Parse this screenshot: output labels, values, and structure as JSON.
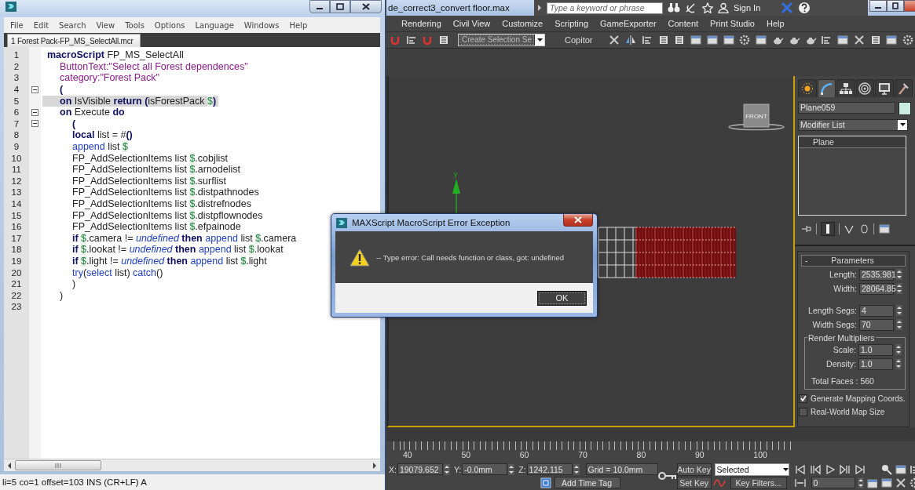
{
  "editor": {
    "menu": [
      "File",
      "Edit",
      "Search",
      "View",
      "Tools",
      "Options",
      "Language",
      "Windows",
      "Help"
    ],
    "tab": "1 Forest Pack-FP_MS_SelectAll.mcr",
    "lines": [
      {
        "number": "1",
        "current": false,
        "fold": false,
        "tokens": [
          {
            "kind": "keyword",
            "text": "macroScript"
          },
          {
            "kind": "plain",
            "text": " FP_MS_SelectAll"
          }
        ]
      },
      {
        "number": "2",
        "current": false,
        "fold": false,
        "tokens": [
          {
            "kind": "string",
            "text": "\tButtonText:\"Select all Forest dependences\""
          }
        ]
      },
      {
        "number": "3",
        "current": false,
        "fold": false,
        "tokens": [
          {
            "kind": "string",
            "text": "\tcategory:\"Forest Pack\""
          }
        ]
      },
      {
        "number": "4",
        "current": false,
        "fold": true,
        "tokens": [
          {
            "kind": "keyword",
            "text": "\t("
          }
        ]
      },
      {
        "number": "5",
        "current": true,
        "fold": false,
        "tokens": [
          {
            "kind": "keyword",
            "text": "\ton"
          },
          {
            "kind": "plain",
            "text": " IsVisible "
          },
          {
            "kind": "keyword",
            "text": "return ("
          },
          {
            "kind": "plain",
            "text": "isForestPack "
          },
          {
            "kind": "dollar",
            "text": "$"
          },
          {
            "kind": "keyword",
            "text": ")"
          }
        ]
      },
      {
        "number": "6",
        "current": false,
        "fold": true,
        "tokens": [
          {
            "kind": "keyword",
            "text": "\ton"
          },
          {
            "kind": "plain",
            "text": " Execute "
          },
          {
            "kind": "keyword",
            "text": "do"
          }
        ]
      },
      {
        "number": "7",
        "current": false,
        "fold": true,
        "tokens": [
          {
            "kind": "keyword",
            "text": "\t\t("
          }
        ]
      },
      {
        "number": "8",
        "current": false,
        "fold": false,
        "tokens": [
          {
            "kind": "keyword",
            "text": "\t\tlocal"
          },
          {
            "kind": "plain",
            "text": " list = #"
          },
          {
            "kind": "keyword",
            "text": "()"
          }
        ]
      },
      {
        "number": "9",
        "current": false,
        "fold": false,
        "tokens": [
          {
            "kind": "function",
            "text": "\t\tappend"
          },
          {
            "kind": "plain",
            "text": " list "
          },
          {
            "kind": "dollar",
            "text": "$"
          }
        ]
      },
      {
        "number": "10",
        "current": false,
        "fold": false,
        "tokens": [
          {
            "kind": "plain",
            "text": "\t\tFP_AddSelectionItems list "
          },
          {
            "kind": "dollar",
            "text": "$"
          },
          {
            "kind": "plain",
            "text": ".cobjlist"
          }
        ]
      },
      {
        "number": "11",
        "current": false,
        "fold": false,
        "tokens": [
          {
            "kind": "plain",
            "text": "\t\tFP_AddSelectionItems list "
          },
          {
            "kind": "dollar",
            "text": "$"
          },
          {
            "kind": "plain",
            "text": ".arnodelist"
          }
        ]
      },
      {
        "number": "12",
        "current": false,
        "fold": false,
        "tokens": [
          {
            "kind": "plain",
            "text": "\t\tFP_AddSelectionItems list "
          },
          {
            "kind": "dollar",
            "text": "$"
          },
          {
            "kind": "plain",
            "text": ".surflist"
          }
        ]
      },
      {
        "number": "13",
        "current": false,
        "fold": false,
        "tokens": [
          {
            "kind": "plain",
            "text": "\t\tFP_AddSelectionItems list "
          },
          {
            "kind": "dollar",
            "text": "$"
          },
          {
            "kind": "plain",
            "text": ".distpathnodes"
          }
        ]
      },
      {
        "number": "14",
        "current": false,
        "fold": false,
        "tokens": [
          {
            "kind": "plain",
            "text": "\t\tFP_AddSelectionItems list "
          },
          {
            "kind": "dollar",
            "text": "$"
          },
          {
            "kind": "plain",
            "text": ".distrefnodes"
          }
        ]
      },
      {
        "number": "15",
        "current": false,
        "fold": false,
        "tokens": [
          {
            "kind": "plain",
            "text": "\t\tFP_AddSelectionItems list "
          },
          {
            "kind": "dollar",
            "text": "$"
          },
          {
            "kind": "plain",
            "text": ".distpflownodes"
          }
        ]
      },
      {
        "number": "16",
        "current": false,
        "fold": false,
        "tokens": [
          {
            "kind": "plain",
            "text": "\t\tFP_AddSelectionItems list "
          },
          {
            "kind": "dollar",
            "text": "$"
          },
          {
            "kind": "plain",
            "text": ".efpainode"
          }
        ]
      },
      {
        "number": "17",
        "current": false,
        "fold": false,
        "tokens": [
          {
            "kind": "keyword",
            "text": "\t\tif "
          },
          {
            "kind": "dollar",
            "text": "$"
          },
          {
            "kind": "plain",
            "text": ".camera != "
          },
          {
            "kind": "constant",
            "text": "undefined "
          },
          {
            "kind": "keyword",
            "text": "then "
          },
          {
            "kind": "function",
            "text": "append"
          },
          {
            "kind": "plain",
            "text": " list "
          },
          {
            "kind": "dollar",
            "text": "$"
          },
          {
            "kind": "plain",
            "text": ".camera"
          }
        ]
      },
      {
        "number": "18",
        "current": false,
        "fold": false,
        "tokens": [
          {
            "kind": "keyword",
            "text": "\t\tif "
          },
          {
            "kind": "dollar",
            "text": "$"
          },
          {
            "kind": "plain",
            "text": ".lookat != "
          },
          {
            "kind": "constant",
            "text": "undefined "
          },
          {
            "kind": "keyword",
            "text": "then "
          },
          {
            "kind": "function",
            "text": "append"
          },
          {
            "kind": "plain",
            "text": " list "
          },
          {
            "kind": "dollar",
            "text": "$"
          },
          {
            "kind": "plain",
            "text": ".lookat"
          }
        ]
      },
      {
        "number": "19",
        "current": false,
        "fold": false,
        "tokens": [
          {
            "kind": "keyword",
            "text": "\t\tif "
          },
          {
            "kind": "dollar",
            "text": "$"
          },
          {
            "kind": "plain",
            "text": ".light != "
          },
          {
            "kind": "constant",
            "text": "undefined "
          },
          {
            "kind": "keyword",
            "text": "then "
          },
          {
            "kind": "function",
            "text": "append"
          },
          {
            "kind": "plain",
            "text": " list "
          },
          {
            "kind": "dollar",
            "text": "$"
          },
          {
            "kind": "plain",
            "text": ".light"
          }
        ]
      },
      {
        "number": "20",
        "current": false,
        "fold": false,
        "tokens": [
          {
            "kind": "function",
            "text": "\t\ttry"
          },
          {
            "kind": "plain",
            "text": "("
          },
          {
            "kind": "function",
            "text": "select"
          },
          {
            "kind": "plain",
            "text": " list) "
          },
          {
            "kind": "function",
            "text": "catch"
          },
          {
            "kind": "plain",
            "text": "()"
          }
        ]
      },
      {
        "number": "21",
        "current": false,
        "fold": false,
        "tokens": [
          {
            "kind": "plain",
            "text": "\t\t)"
          }
        ]
      },
      {
        "number": "22",
        "current": false,
        "fold": false,
        "tokens": [
          {
            "kind": "plain",
            "text": "\t)"
          }
        ]
      },
      {
        "number": "23",
        "current": false,
        "fold": false
      }
    ],
    "status": "li=5 co=1 offset=103 INS (CR+LF) A"
  },
  "max": {
    "title": "de_correct3_convert floor.max",
    "search": {
      "placeholder": "Type a keyword or phrase"
    },
    "sign_in": "Sign In",
    "menu": [
      "Rendering",
      "Civil View",
      "Customize",
      "Scripting",
      "GameExporter",
      "Content",
      "Print Studio",
      "Help"
    ],
    "selection_set": "Create Selection Se",
    "copitor": "Copitor",
    "viewport": {
      "axis_label": "y",
      "viewcube": "FRONT"
    },
    "command_panel": {
      "tabs": [
        {
          "selected": false
        },
        {
          "selected": true
        },
        {
          "selected": false
        },
        {
          "selected": false
        },
        {
          "selected": false
        },
        {
          "selected": false
        }
      ],
      "object_name": "Plane059",
      "modifier_list": "Modifier List",
      "stack": [
        "Plane"
      ],
      "rollout": {
        "toggle": "-",
        "title": "Parameters",
        "fields": [
          {
            "label": "Length:",
            "value": "2535.981"
          },
          {
            "label": "Width:",
            "value": "28064.85"
          },
          {
            "label": "Length Segs:",
            "value": "4"
          },
          {
            "label": "Width Segs:",
            "value": "70"
          }
        ],
        "group": {
          "title": "Render Multipliers",
          "fields": [
            {
              "label": "Scale:",
              "value": "1.0"
            },
            {
              "label": "Density:",
              "value": "1.0"
            }
          ],
          "total_faces": "Total Faces : 560"
        },
        "checkboxes": [
          {
            "label": "Generate Mapping Coords.",
            "checked": true
          },
          {
            "label": "Real-World Map Size",
            "checked": false
          }
        ]
      }
    },
    "timeline": {
      "ticks": [
        "40",
        "50",
        "60",
        "70",
        "80",
        "90",
        "100"
      ]
    },
    "status": {
      "coords": [
        {
          "label": "X:",
          "value": "19079.652"
        },
        {
          "label": "Y:",
          "value": "-0.0mm"
        },
        {
          "label": "Z:",
          "value": "1242.115"
        }
      ],
      "grid": "Grid = 10.0mm",
      "add_time_tag": "Add Time Tag",
      "auto_key": "Auto Key",
      "key_mode": "Selected",
      "set_key": "Set Key",
      "key_filters": "Key Filters...",
      "frame": "0"
    }
  },
  "dialog": {
    "title": "MAXScript MacroScript Error Exception",
    "message": "-- Type error: Call needs function or class, got: undefined",
    "button": "OK"
  }
}
